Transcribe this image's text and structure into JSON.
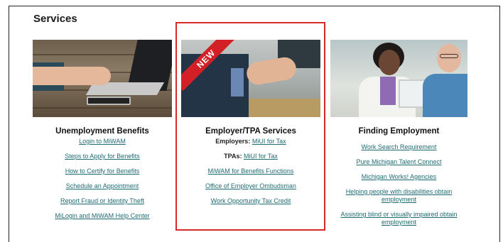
{
  "section": {
    "title": "Services"
  },
  "columns": [
    {
      "heading": "Unemployment Benefits",
      "badge": null,
      "links": [
        {
          "label": null,
          "text": "Login to MiWAM"
        },
        {
          "label": null,
          "text": "Steps to Apply for Benefits"
        },
        {
          "label": null,
          "text": "How to Certify for Benefits"
        },
        {
          "label": null,
          "text": "Schedule an Appointment"
        },
        {
          "label": null,
          "text": "Report Fraud or Identity Theft"
        },
        {
          "label": null,
          "text": "MiLogin and MiWAM Help Center"
        }
      ]
    },
    {
      "heading": "Employer/TPA Services",
      "badge": "NEW",
      "links": [
        {
          "label": "Employers:",
          "text": "MiUI for Tax"
        },
        {
          "label": "TPAs:",
          "text": "MiUI for Tax"
        },
        {
          "label": null,
          "text": "MiWAM for Benefits Functions"
        },
        {
          "label": null,
          "text": "Office of Employer Ombudsman"
        },
        {
          "label": null,
          "text": "Work Opportunity Tax Credit"
        }
      ]
    },
    {
      "heading": "Finding Employment",
      "badge": null,
      "links": [
        {
          "label": null,
          "text": "Work Search Requirement"
        },
        {
          "label": null,
          "text": "Pure Michigan Talent Connect"
        },
        {
          "label": null,
          "text": "Michigan Works! Agencies"
        },
        {
          "label": null,
          "text": "Helping people with disabilities obtain employment"
        },
        {
          "label": null,
          "text": "Assisting blind or visually impaired obtain employment"
        }
      ]
    }
  ],
  "colors": {
    "link": "#1f6b73",
    "highlight": "#d42a2a",
    "badge": "#d31f26"
  }
}
